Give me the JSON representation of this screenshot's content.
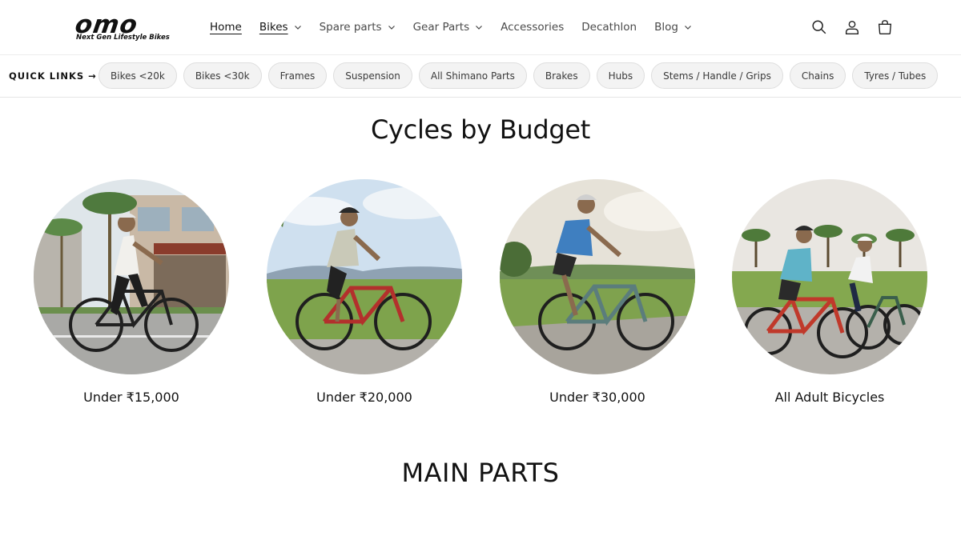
{
  "brand": {
    "logo_text": "omo",
    "tagline": "Next Gen Lifestyle Bikes"
  },
  "nav": {
    "items": [
      {
        "label": "Home",
        "has_dropdown": false
      },
      {
        "label": "Bikes",
        "has_dropdown": true
      },
      {
        "label": "Spare parts",
        "has_dropdown": true
      },
      {
        "label": "Gear Parts",
        "has_dropdown": true
      },
      {
        "label": "Accessories",
        "has_dropdown": false
      },
      {
        "label": "Decathlon",
        "has_dropdown": false
      },
      {
        "label": "Blog",
        "has_dropdown": true
      }
    ]
  },
  "header_icons": [
    "search-icon",
    "account-icon",
    "cart-icon"
  ],
  "quick_links": {
    "label": "QUICK LINKS →",
    "chips": [
      "Bikes <20k",
      "Bikes <30k",
      "Frames",
      "Suspension",
      "All Shimano Parts",
      "Brakes",
      "Hubs",
      "Stems / Handle / Grips",
      "Chains",
      "Tyres / Tubes"
    ]
  },
  "budget_section": {
    "title": "Cycles by Budget",
    "cards": [
      {
        "label": "Under ₹15,000",
        "scene": "city"
      },
      {
        "label": "Under ₹20,000",
        "scene": "field"
      },
      {
        "label": "Under ₹30,000",
        "scene": "rural"
      },
      {
        "label": "All Adult Bicycles",
        "scene": "couple"
      }
    ]
  },
  "parts_section": {
    "title": "MAIN PARTS"
  },
  "colors": {
    "text": "#121212",
    "chip_bg": "#f3f3f3",
    "chip_border": "#dedede"
  }
}
